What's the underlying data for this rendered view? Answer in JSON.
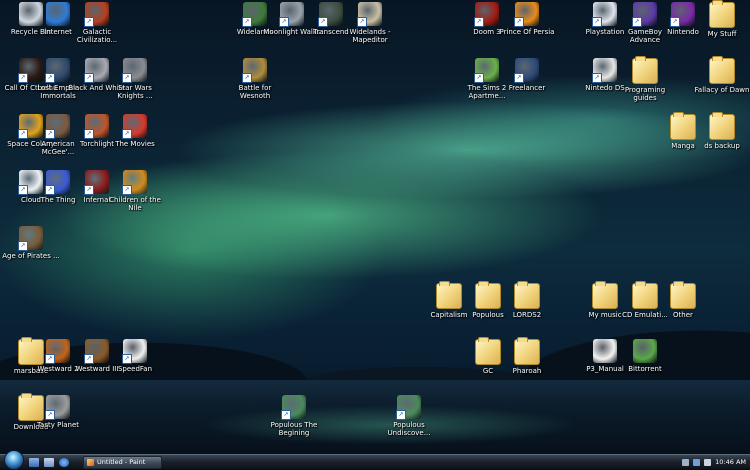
{
  "desktop": {
    "icons": [
      {
        "name": "recycle-bin-icon",
        "label": "Recycle Bin",
        "shortcut": false,
        "color": "#cfd6df"
      },
      {
        "name": "internet-icon",
        "label": "Internet",
        "shortcut": false,
        "color": "#2f7bd6"
      },
      {
        "name": "galactic-civilizations-icon",
        "label": "Galactic Civilizatio...",
        "shortcut": true,
        "color": "#b5401e"
      },
      {
        "name": "widelands-icon",
        "label": "Widelands",
        "shortcut": true,
        "color": "#3f7a3a"
      },
      {
        "name": "moonlight-walks-icon",
        "label": "Moonlight Walks",
        "shortcut": true,
        "color": "#9aa2aa"
      },
      {
        "name": "transcend-icon",
        "label": "Transcend",
        "shortcut": true,
        "color": "#3c4d3f"
      },
      {
        "name": "widelands-mapeditor-icon",
        "label": "Widelands - Mapeditor",
        "shortcut": true,
        "color": "#c9c0a4"
      },
      {
        "name": "doom-3-icon",
        "label": "Doom 3",
        "shortcut": true,
        "color": "#a21b12"
      },
      {
        "name": "prince-of-persia-icon",
        "label": "Prince Of Persia",
        "shortcut": true,
        "color": "#e88b1b"
      },
      {
        "name": "playstation-icon",
        "label": "Playstation",
        "shortcut": true,
        "color": "#e0e4ee"
      },
      {
        "name": "gameboy-advance-icon",
        "label": "GameBoy Advance",
        "shortcut": true,
        "color": "#5c3aa6"
      },
      {
        "name": "nintendo-icon",
        "label": "Nintendo",
        "shortcut": true,
        "color": "#7a2aa6"
      },
      {
        "name": "my-stuff-folder-icon",
        "label": "My Stuff",
        "shortcut": false,
        "color": "folder"
      },
      {
        "name": "call-of-cthulhu-icon",
        "label": "Call Of Cthulhu",
        "shortcut": true,
        "color": "#2b1a14"
      },
      {
        "name": "lost-empire-immortals-icon",
        "label": "Lost Empire Immortals",
        "shortcut": true,
        "color": "#2f4a6b"
      },
      {
        "name": "black-and-white-icon",
        "label": "Black And White",
        "shortcut": true,
        "color": "#a9a9b3"
      },
      {
        "name": "star-wars-knights-icon",
        "label": "Star Wars Knights ...",
        "shortcut": true,
        "color": "#8b8c91"
      },
      {
        "name": "battle-for-wesnoth-icon",
        "label": "Battle for Wesnoth",
        "shortcut": true,
        "color": "#b08c3c"
      },
      {
        "name": "the-sims-2-apartment-icon",
        "label": "The Sims 2 Apartme...",
        "shortcut": true,
        "color": "#6ab04a"
      },
      {
        "name": "freelancer-icon",
        "label": "Freelancer",
        "shortcut": true,
        "color": "#2c4a78"
      },
      {
        "name": "nintendo-ds-icon",
        "label": "Nintedo DS",
        "shortcut": true,
        "color": "#e6e6e6"
      },
      {
        "name": "programing-guides-folder-icon",
        "label": "Programing guides",
        "shortcut": false,
        "color": "folder"
      },
      {
        "name": "fallacy-of-dawn-folder-icon",
        "label": "Fallacy of Dawn",
        "shortcut": false,
        "color": "folder"
      },
      {
        "name": "space-colony-icon",
        "label": "Space Colony",
        "shortcut": true,
        "color": "#e0a21a"
      },
      {
        "name": "american-mcgee-icon",
        "label": "American McGee'...",
        "shortcut": true,
        "color": "#7a5a40"
      },
      {
        "name": "torchlight-icon",
        "label": "Torchlight",
        "shortcut": true,
        "color": "#c0552a"
      },
      {
        "name": "the-movies-icon",
        "label": "The Movies",
        "shortcut": true,
        "color": "#d63a2a"
      },
      {
        "name": "manga-folder-icon",
        "label": "Manga",
        "shortcut": false,
        "color": "folder"
      },
      {
        "name": "ds-backup-folder-icon",
        "label": "ds backup",
        "shortcut": false,
        "color": "folder"
      },
      {
        "name": "cloud-icon",
        "label": "Cloud",
        "shortcut": true,
        "color": "#eef2f6"
      },
      {
        "name": "the-thing-icon",
        "label": "The Thing",
        "shortcut": true,
        "color": "#3a5ad6"
      },
      {
        "name": "infernal-icon",
        "label": "Infernal",
        "shortcut": true,
        "color": "#8c1a1a"
      },
      {
        "name": "children-of-the-nile-icon",
        "label": "Children of the Nile",
        "shortcut": true,
        "color": "#d28a1a"
      },
      {
        "name": "age-of-pirates-icon",
        "label": "Age of Pirates ...",
        "shortcut": true,
        "color": "#7a5a3a"
      },
      {
        "name": "capitalism-folder-icon",
        "label": "Capitalism",
        "shortcut": false,
        "color": "folder"
      },
      {
        "name": "populous-folder-icon",
        "label": "Populous",
        "shortcut": false,
        "color": "folder"
      },
      {
        "name": "lords2-folder-icon",
        "label": "LORDS2",
        "shortcut": false,
        "color": "folder"
      },
      {
        "name": "my-music-folder-icon",
        "label": "My music",
        "shortcut": false,
        "color": "folder"
      },
      {
        "name": "cd-emulator-folder-icon",
        "label": "CD Emulati...",
        "shortcut": false,
        "color": "folder"
      },
      {
        "name": "other-folder-icon",
        "label": "Other",
        "shortcut": false,
        "color": "folder"
      },
      {
        "name": "marsbase-folder-icon",
        "label": "marsbase",
        "shortcut": false,
        "color": "folder"
      },
      {
        "name": "westward-2-icon",
        "label": "Westward 2",
        "shortcut": true,
        "color": "#c2631a"
      },
      {
        "name": "westward-3-icon",
        "label": "Westward III",
        "shortcut": true,
        "color": "#8a5a2a"
      },
      {
        "name": "speedfan-icon",
        "label": "SpeedFan",
        "shortcut": true,
        "color": "#f1f1f1"
      },
      {
        "name": "gc-folder-icon",
        "label": "GC",
        "shortcut": false,
        "color": "folder"
      },
      {
        "name": "pharoah-folder-icon",
        "label": "Pharoah",
        "shortcut": false,
        "color": "folder"
      },
      {
        "name": "p3-manual-icon",
        "label": "P3_Manual",
        "shortcut": false,
        "color": "#f3f3f3"
      },
      {
        "name": "bittorrent-icon",
        "label": "Bittorrent",
        "shortcut": false,
        "color": "#5aa84a"
      },
      {
        "name": "download-folder-icon",
        "label": "Download",
        "shortcut": false,
        "color": "folder"
      },
      {
        "name": "tasty-planet-icon",
        "label": "Tasty Planet",
        "shortcut": true,
        "color": "#9c9c9c"
      },
      {
        "name": "populous-the-beginning-icon",
        "label": "Populous The Begining",
        "shortcut": true,
        "color": "#4a8a5a"
      },
      {
        "name": "populous-undiscovered-icon",
        "label": "Populous Undiscove...",
        "shortcut": true,
        "color": "#4a8a5a"
      }
    ]
  },
  "taskbar": {
    "paint_window_label": "Untitled - Paint",
    "clock": "10:46 AM"
  }
}
